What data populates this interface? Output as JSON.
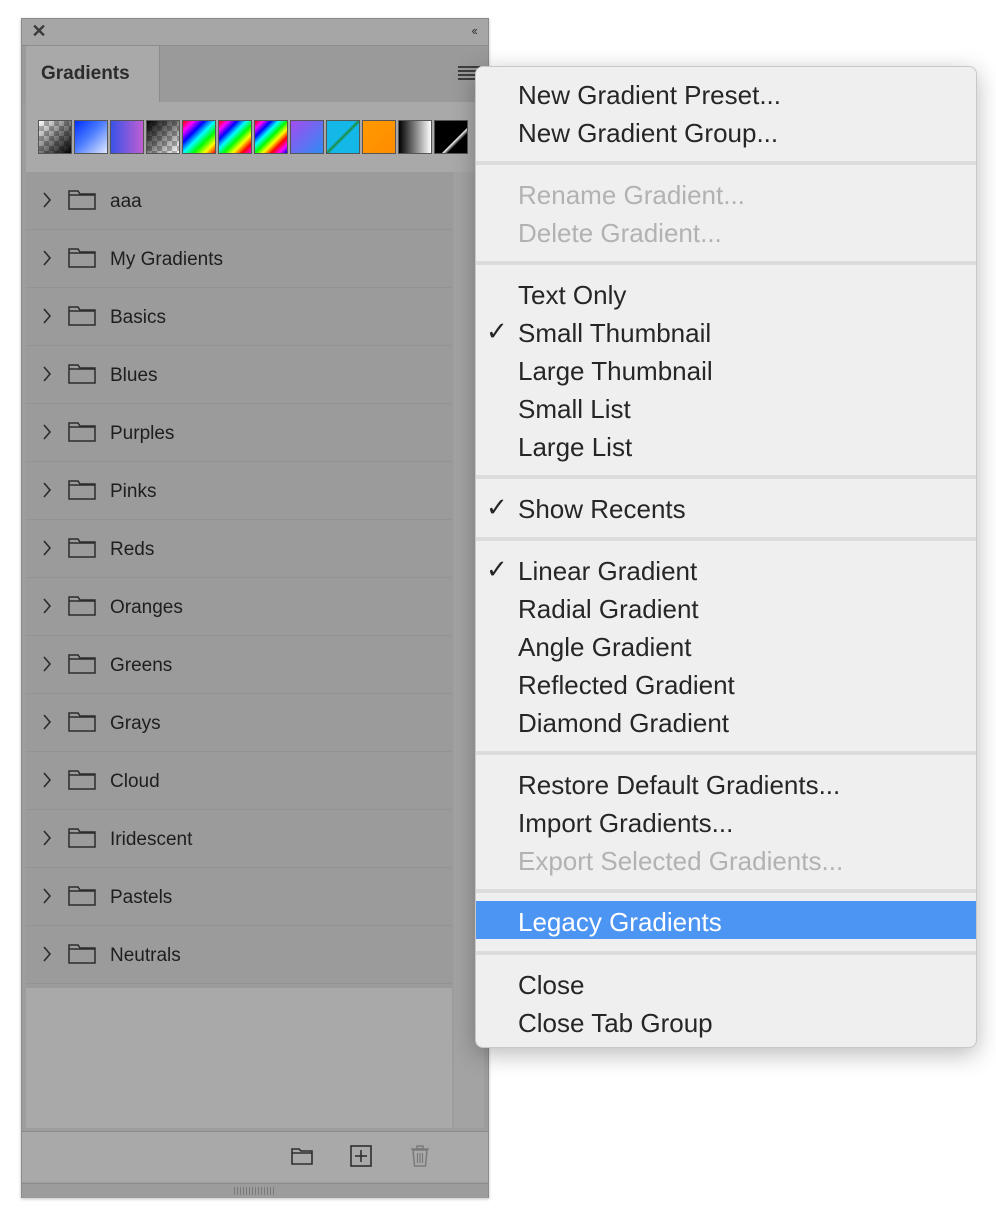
{
  "panel": {
    "tab_label": "Gradients",
    "close_glyph": "✕",
    "collapse_glyph": "‹‹",
    "swatches": [
      {
        "name": "transparent-to-black"
      },
      {
        "name": "blue-to-white"
      },
      {
        "name": "blue-to-pink"
      },
      {
        "name": "black-to-transparent"
      },
      {
        "name": "spectrum-1"
      },
      {
        "name": "spectrum-2"
      },
      {
        "name": "spectrum-3"
      },
      {
        "name": "violet-to-blue"
      },
      {
        "name": "cyan-to-green"
      },
      {
        "name": "orange"
      },
      {
        "name": "black-to-white"
      },
      {
        "name": "black-diagonal"
      }
    ],
    "groups": [
      {
        "label": "aaa"
      },
      {
        "label": "My Gradients"
      },
      {
        "label": "Basics"
      },
      {
        "label": "Blues"
      },
      {
        "label": "Purples"
      },
      {
        "label": "Pinks"
      },
      {
        "label": "Reds"
      },
      {
        "label": "Oranges"
      },
      {
        "label": "Greens"
      },
      {
        "label": "Grays"
      },
      {
        "label": "Cloud"
      },
      {
        "label": "Iridescent"
      },
      {
        "label": "Pastels"
      },
      {
        "label": "Neutrals"
      }
    ],
    "bottom_icons": [
      "folder-icon",
      "new-preset-icon",
      "trash-icon"
    ]
  },
  "menu": {
    "items": [
      {
        "label": "New Gradient Preset...",
        "checked": false,
        "disabled": false
      },
      {
        "label": "New Gradient Group...",
        "checked": false,
        "disabled": false
      },
      {
        "label": "Rename Gradient...",
        "checked": false,
        "disabled": true
      },
      {
        "label": "Delete Gradient...",
        "checked": false,
        "disabled": true
      },
      {
        "label": "Text Only",
        "checked": false,
        "disabled": false
      },
      {
        "label": "Small Thumbnail",
        "checked": true,
        "disabled": false
      },
      {
        "label": "Large Thumbnail",
        "checked": false,
        "disabled": false
      },
      {
        "label": "Small List",
        "checked": false,
        "disabled": false
      },
      {
        "label": "Large List",
        "checked": false,
        "disabled": false
      },
      {
        "label": "Show Recents",
        "checked": true,
        "disabled": false
      },
      {
        "label": "Linear Gradient",
        "checked": true,
        "disabled": false
      },
      {
        "label": "Radial Gradient",
        "checked": false,
        "disabled": false
      },
      {
        "label": "Angle Gradient",
        "checked": false,
        "disabled": false
      },
      {
        "label": "Reflected Gradient",
        "checked": false,
        "disabled": false
      },
      {
        "label": "Diamond Gradient",
        "checked": false,
        "disabled": false
      },
      {
        "label": "Restore Default Gradients...",
        "checked": false,
        "disabled": false
      },
      {
        "label": "Import Gradients...",
        "checked": false,
        "disabled": false
      },
      {
        "label": "Export Selected Gradients...",
        "checked": false,
        "disabled": true
      },
      {
        "label": "Legacy Gradients",
        "checked": false,
        "disabled": false,
        "highlighted": true
      },
      {
        "label": "Close",
        "checked": false,
        "disabled": false
      },
      {
        "label": "Close Tab Group",
        "checked": false,
        "disabled": false
      }
    ],
    "check_glyph": "✓",
    "highlight_color": "#4d95f2",
    "disabled_color": "#b2b2b2"
  }
}
